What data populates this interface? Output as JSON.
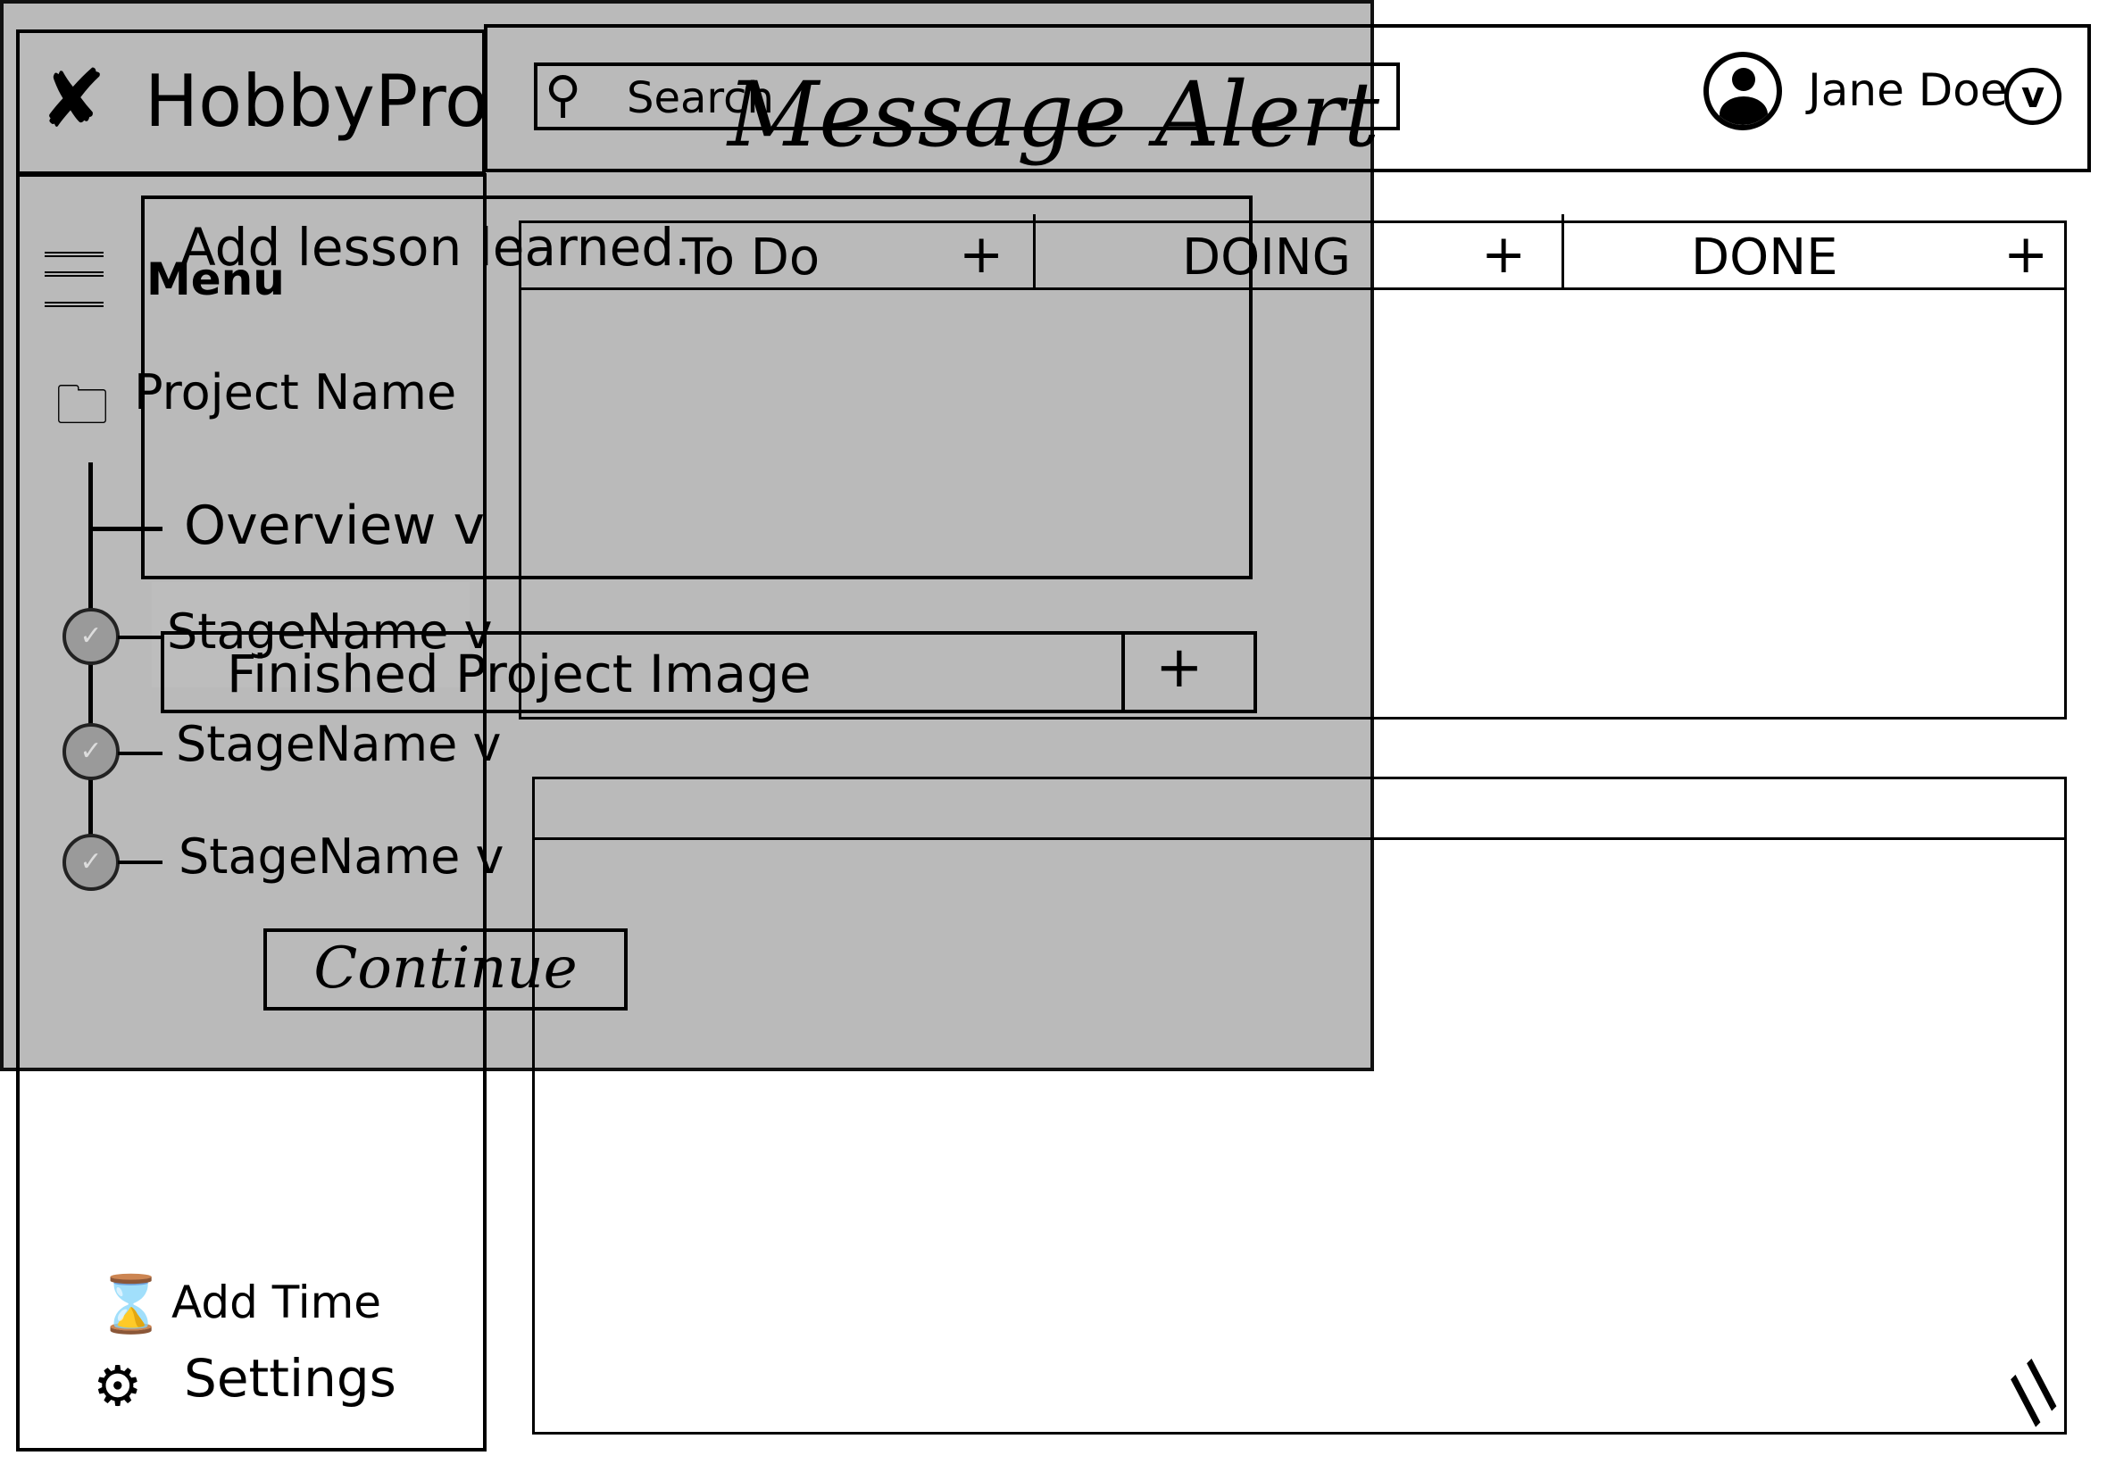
{
  "app": {
    "name": "HobbyPro"
  },
  "search": {
    "placeholder": "Search"
  },
  "user": {
    "name": "Jane Doe"
  },
  "sidebar": {
    "menu_label": "Menu",
    "project_name": "Project Name",
    "overview": "Overview",
    "stages": [
      "StageName",
      "StageName",
      "StageName"
    ],
    "add_time": "Add Time",
    "settings": "Settings"
  },
  "board": {
    "columns": [
      "To Do",
      "DOING",
      "DONE"
    ],
    "add": "+"
  },
  "modal": {
    "title": "Message Alert",
    "message": "Add lesson learned.",
    "image_field": "Finished Project Image",
    "image_add": "+",
    "continue": "Continue"
  },
  "colors": {
    "modal_bg": "#bababa",
    "highlight": "#bdbdbd",
    "stage_circle": "#9a9a9a"
  }
}
